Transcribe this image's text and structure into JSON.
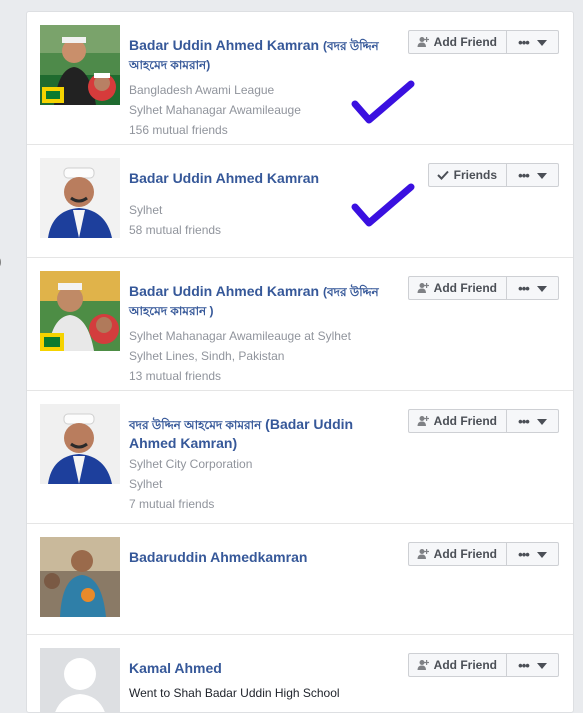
{
  "edge_glyph": ")",
  "buttons": {
    "add_friend": "Add Friend",
    "friends": "Friends"
  },
  "results": [
    {
      "name_latin": "Badar Uddin Ahmed Kamran",
      "name_bangla": "(বদর উদ্দিন আহমেদ কামরান)",
      "details": [
        "Bangladesh Awami League",
        "Sylhet Mahanagar Awamileauge",
        "156 mutual friends"
      ],
      "status": "add_friend",
      "checked": true
    },
    {
      "name_latin": "Badar Uddin Ahmed Kamran",
      "details": [
        "Sylhet",
        "58 mutual friends"
      ],
      "status": "friends",
      "checked": true
    },
    {
      "name_latin": "Badar Uddin Ahmed Kamran",
      "name_bangla": "(বদর উদ্দিন আহমেদ কামরান )",
      "details": [
        "Sylhet Mahanagar Awamileauge at Sylhet",
        "Sylhet Lines, Sindh, Pakistan",
        "13 mutual friends"
      ],
      "status": "add_friend",
      "checked": false
    },
    {
      "name_bangla": "বদর উদ্দিন আহমেদ কামরান",
      "name_latin": "(Badar Uddin Ahmed Kamran)",
      "details": [
        "Sylhet City Corporation",
        "Sylhet",
        "7 mutual friends"
      ],
      "status": "add_friend",
      "checked": false
    },
    {
      "name_latin": "Badaruddin Ahmedkamran",
      "details": [],
      "status": "add_friend",
      "checked": false
    },
    {
      "name_latin": "Kamal Ahmed",
      "details": [
        "Went to Shah Badar Uddin High School"
      ],
      "status": "add_friend",
      "checked": false
    }
  ],
  "colors": {
    "link": "#365899",
    "secondary_text": "#90949c",
    "button_bg": "#f6f7f9",
    "button_border": "#ced0d4",
    "check_mark": "#3a10e0"
  }
}
